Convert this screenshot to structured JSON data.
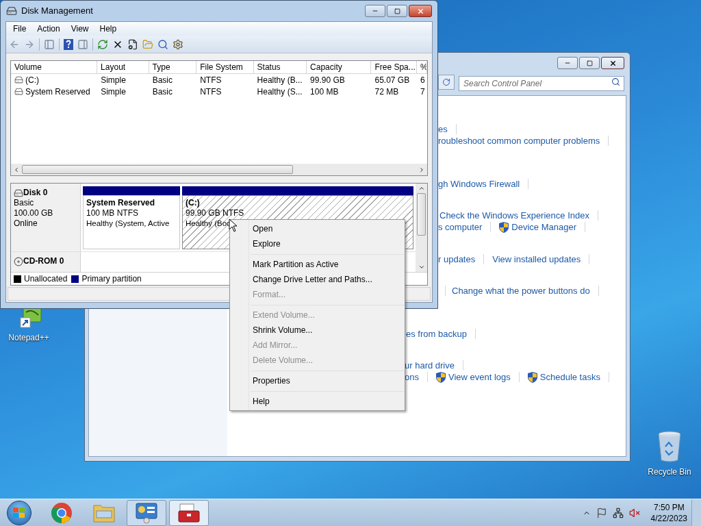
{
  "disk_management": {
    "title": "Disk Management",
    "menu": [
      "File",
      "Action",
      "View",
      "Help"
    ],
    "volumes": {
      "columns": [
        "Volume",
        "Layout",
        "Type",
        "File System",
        "Status",
        "Capacity",
        "Free Spa...",
        "%"
      ],
      "rows": [
        [
          "(C:)",
          "Simple",
          "Basic",
          "NTFS",
          "Healthy (B...",
          "99.90 GB",
          "65.07 GB",
          "6"
        ],
        [
          "System Reserved",
          "Simple",
          "Basic",
          "NTFS",
          "Healthy (S...",
          "100 MB",
          "72 MB",
          "7"
        ]
      ]
    },
    "disks": [
      {
        "name": "Disk 0",
        "kind": "disk",
        "lines": [
          "Basic",
          "100.00 GB",
          "Online"
        ],
        "partitions": [
          {
            "title": "System Reserved",
            "size": "100 MB NTFS",
            "status": "Healthy (System, Active",
            "selected": false
          },
          {
            "title": "(C:)",
            "size": "99.90 GB NTFS",
            "status": "Healthy (Boo",
            "selected": true
          }
        ]
      },
      {
        "name": "CD-ROM 0",
        "kind": "cdrom"
      }
    ],
    "legend": [
      {
        "label": "Unallocated",
        "color": "#000000"
      },
      {
        "label": "Primary partition",
        "color": "#000080"
      }
    ]
  },
  "control_panel": {
    "search": {
      "placeholder": "Search Control Panel"
    },
    "rows": [
      {
        "links": [
          {
            "text": "es",
            "shield": false
          }
        ]
      },
      {
        "links": [
          {
            "text": "roubleshoot common computer problems",
            "shield": false
          }
        ]
      },
      {
        "links": [
          {
            "text": "gh Windows Firewall",
            "shield": false
          }
        ]
      },
      {
        "links": [
          {
            "text": "Check the Windows Experience Index",
            "shield": false
          }
        ]
      },
      {
        "links": [
          {
            "text": "s computer",
            "shield": false
          },
          {
            "text": "Device Manager",
            "shield": true
          }
        ]
      },
      {
        "links": [
          {
            "text": "r updates",
            "shield": false
          },
          {
            "text": "View installed updates",
            "shield": false
          }
        ]
      },
      {
        "links": [
          {
            "text": "Change what the power buttons do",
            "shield": false
          }
        ]
      },
      {
        "links": [
          {
            "text": "es from backup",
            "shield": false
          }
        ]
      },
      {
        "links": [
          {
            "text": "ur hard drive",
            "shield": false
          }
        ]
      },
      {
        "links": [
          {
            "text": "ons",
            "shield": false
          },
          {
            "text": "View event logs",
            "shield": true
          },
          {
            "text": "Schedule tasks",
            "shield": true
          }
        ]
      }
    ]
  },
  "context_menu": {
    "items": [
      {
        "kind": "item",
        "label": "Open",
        "disabled": false
      },
      {
        "kind": "item",
        "label": "Explore",
        "disabled": false
      },
      {
        "kind": "separator"
      },
      {
        "kind": "item",
        "label": "Mark Partition as Active",
        "disabled": false
      },
      {
        "kind": "item",
        "label": "Change Drive Letter and Paths...",
        "disabled": false
      },
      {
        "kind": "item",
        "label": "Format...",
        "disabled": true
      },
      {
        "kind": "separator"
      },
      {
        "kind": "item",
        "label": "Extend Volume...",
        "disabled": true
      },
      {
        "kind": "item",
        "label": "Shrink Volume...",
        "disabled": false
      },
      {
        "kind": "item",
        "label": "Add Mirror...",
        "disabled": true
      },
      {
        "kind": "item",
        "label": "Delete Volume...",
        "disabled": true
      },
      {
        "kind": "separator"
      },
      {
        "kind": "item",
        "label": "Properties",
        "disabled": false
      },
      {
        "kind": "separator"
      },
      {
        "kind": "item",
        "label": "Help",
        "disabled": false
      }
    ]
  },
  "desktop_icons": [
    {
      "kind": "notepad",
      "label": "Notepad++"
    },
    {
      "kind": "recycle",
      "label": "Recycle Bin"
    }
  ],
  "taskbar": {
    "apps": [
      {
        "kind": "browser",
        "running": false,
        "selected": false
      },
      {
        "kind": "explorer",
        "running": false,
        "selected": false
      },
      {
        "kind": "control-panel",
        "running": true,
        "selected": false
      },
      {
        "kind": "toolbox",
        "running": true,
        "selected": true
      }
    ],
    "clock": {
      "time": "7:50 PM",
      "date": "4/22/2023"
    }
  }
}
